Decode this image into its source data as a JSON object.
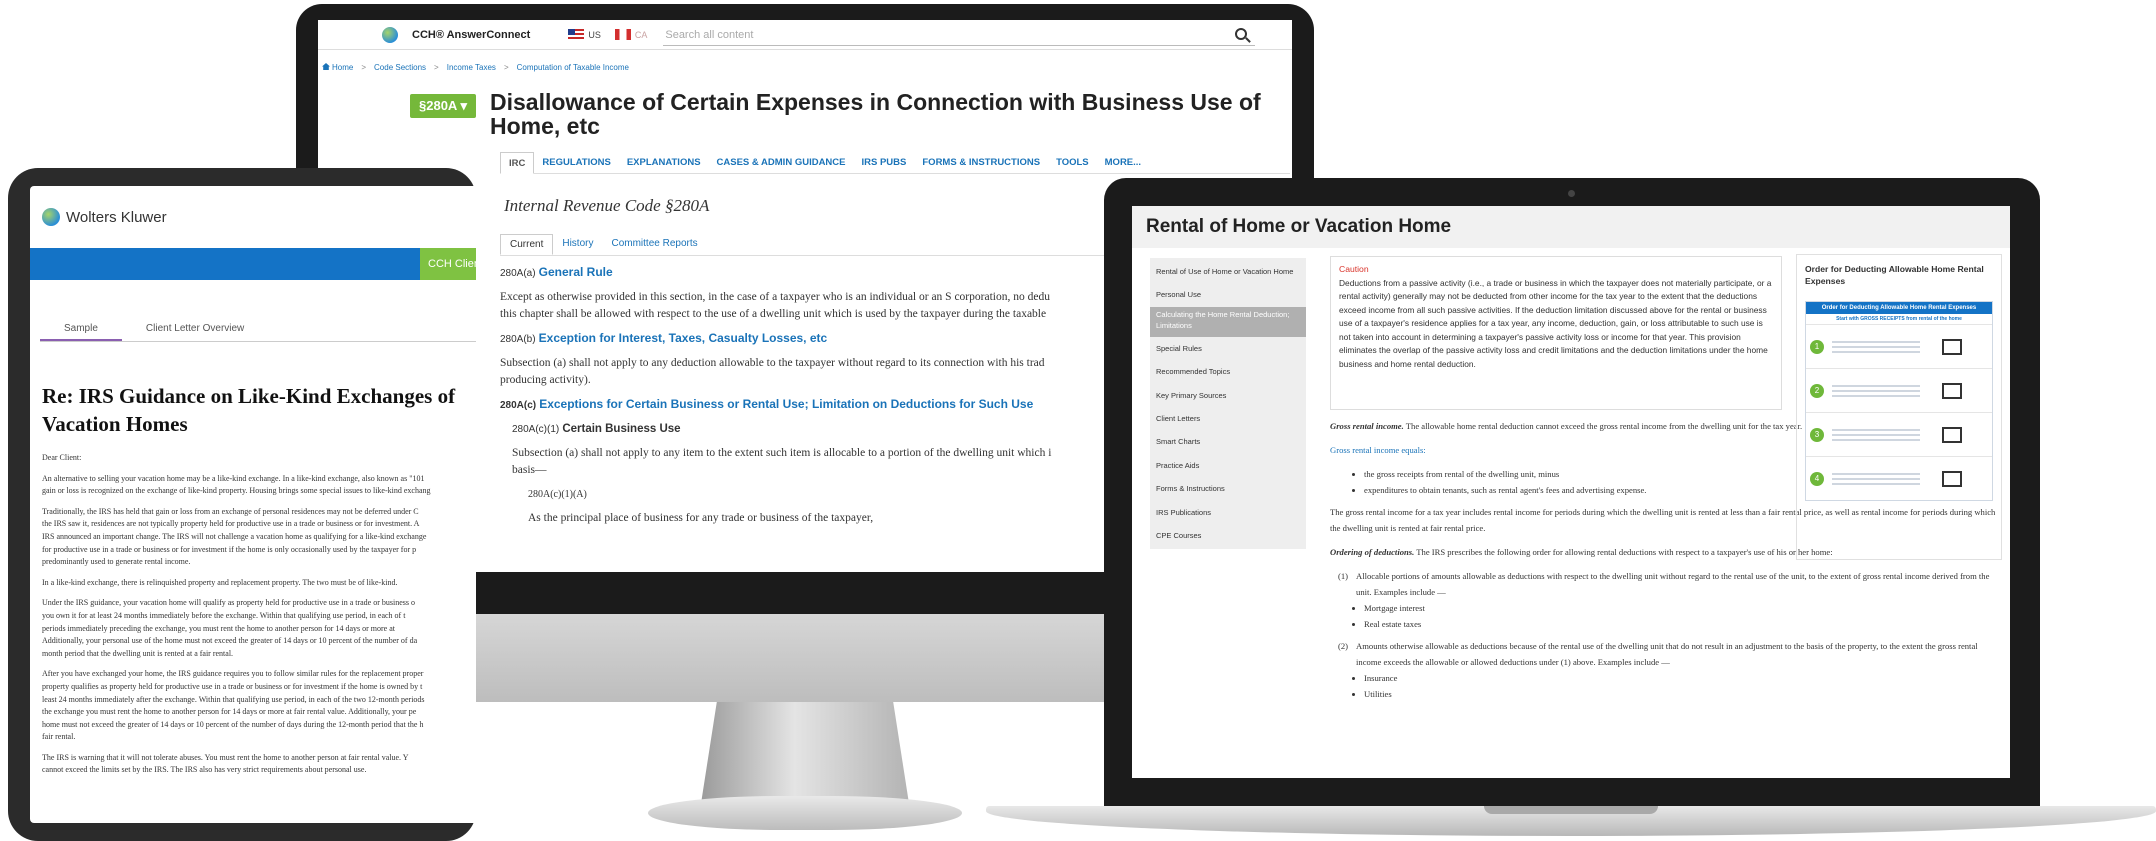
{
  "monitor": {
    "brand": "CCH® AnswerConnect",
    "locale_us": "US",
    "locale_ca": "CA",
    "search_placeholder": "Search all content",
    "breadcrumbs": [
      "Home",
      "Code Sections",
      "Income Taxes",
      "Computation of Taxable Income"
    ],
    "badge": "§280A ▾",
    "title": "Disallowance of Certain Expenses in Connection with Business Use of Home, etc",
    "nav": [
      "IRC",
      "REGULATIONS",
      "EXPLANATIONS",
      "CASES & ADMIN GUIDANCE",
      "IRS PUBS",
      "FORMS & INSTRUCTIONS",
      "TOOLS",
      "MORE..."
    ],
    "section_title": "Internal Revenue Code §280A",
    "tabs": [
      "Current",
      "History",
      "Committee Reports"
    ],
    "sections": [
      {
        "code": "280A(a)",
        "head": "General Rule",
        "text": "Except as otherwise provided in this section, in the case of a taxpayer who is an individual or an S corporation, no dedu",
        "text2": "this chapter shall be allowed with respect to the use of a dwelling unit which is used by the taxpayer during the taxable"
      },
      {
        "code": "280A(b)",
        "head": "Exception for Interest, Taxes, Casualty Losses, etc",
        "text": "Subsection (a) shall not apply to any deduction allowable to the taxpayer without regard to its connection with his trad",
        "text2": "producing activity)."
      },
      {
        "code": "280A(c)",
        "head": "Exceptions for Certain Business or Rental Use; Limitation on Deductions for Such Use"
      }
    ],
    "c1_code": "280A(c)(1)",
    "c1_head": "Certain Business Use",
    "c1_text": "Subsection (a) shall not apply to any item to the extent such item is allocable to a portion of the dwelling unit which i",
    "c1_text2": "basis—",
    "c1a_code": "280A(c)(1)(A)",
    "c1a_text": "As the principal place of business for any trade or business of the taxpayer,"
  },
  "tablet": {
    "logo": "Wolters Kluwer",
    "cch_label": "CCH Client",
    "tabs": [
      "Sample",
      "Client Letter Overview"
    ],
    "title": "Re: IRS Guidance on Like-Kind Exchanges of Vacation Homes",
    "paragraphs": [
      "Dear Client:",
      "An alternative to selling your vacation home may be a like-kind exchange. In a like-kind exchange, also known as \"101",
      "gain or loss is recognized on the exchange of like-kind property. Housing brings some special issues to like-kind exchang",
      "Traditionally, the IRS has held that gain or loss from an exchange of personal residences may not be deferred under C",
      "the IRS saw it, residences are not typically property held for productive use in a trade or business or for investment. A",
      "IRS announced an important change. The IRS will not challenge a vacation home as qualifying for a like-kind exchange",
      "for productive use in a trade or business or for investment if the home is only occasionally used by the taxpayer for p",
      "predominantly used to generate rental income.",
      "In a like-kind exchange, there is relinquished property and replacement property. The two must be of like-kind.",
      "Under the IRS guidance, your vacation home will qualify as property held for productive use in a trade or business o",
      "you own it for at least 24 months immediately before the exchange. Within that qualifying use period, in each of t",
      "periods immediately preceding the exchange, you must rent the home to another person for 14 days or more at",
      "Additionally, your personal use of the home must not exceed the greater of 14 days or 10 percent of the number of da",
      "month period that the dwelling unit is rented at a fair rental.",
      "After you have exchanged your home, the IRS guidance requires you to follow similar rules for the replacement proper",
      "property qualifies as property held for productive use in a trade or business or for investment if the home is owned by t",
      "least 24 months immediately after the exchange. Within that qualifying use period, in each of the two 12-month periods",
      "the exchange you must rent the home to another person for 14 days or more at fair rental value. Additionally, your pe",
      "home must not exceed the greater of 14 days or 10 percent of the number of days during the 12-month period that the h",
      "fair rental.",
      "The IRS is warning that it will not tolerate abuses. You must rent the home to another person at fair rental value. Y",
      "cannot exceed the limits set by the IRS. The IRS also has very strict requirements about personal use."
    ]
  },
  "laptop": {
    "title": "Rental of Home or Vacation Home",
    "sidebar": [
      "Rental of Use of Home or Vacation Home",
      "Personal Use",
      "Calculating the Home Rental Deduction; Limitations",
      "Special Rules",
      "Recommended Topics",
      "Key Primary Sources",
      "Client Letters",
      "Smart Charts",
      "Practice Aids",
      "Forms & Instructions",
      "IRS Publications",
      "CPE Courses"
    ],
    "sidebar_active_index": 2,
    "caution_label": "Caution",
    "caution_text": "Deductions from a passive activity (i.e., a trade or business in which the taxpayer does not materially participate, or a rental activity) generally may not be deducted from other income for the tax year to the extent that the deductions exceed income from all such passive activities. If the deduction limitation discussed above for the rental or business use of a taxpayer's residence applies for a tax year, any income, deduction, gain, or loss attributable to such use is not taken into account in determining a taxpayer's passive activity loss or income for that year. This provision eliminates the overlap of the passive activity loss and credit limitations and the deduction limitations under the home business and home rental deduction.",
    "gross_rental_label": "Gross rental income.",
    "gross_rental_text": "The allowable home rental deduction cannot exceed the gross rental income from the dwelling unit for the tax year.",
    "equals_intro": "Gross rental income equals:",
    "equals_items": [
      "the gross receipts from rental of the dwelling unit, minus",
      "expenditures to obtain tenants, such as rental agent's fees and advertising expense."
    ],
    "includes_text": "The gross rental income for a tax year includes rental income for periods during which the dwelling unit is rented at less than a fair rental price, as well as rental income for periods during which the dwelling unit is rented at fair rental price.",
    "ordering_label": "Ordering of deductions.",
    "ordering_text": "The IRS prescribes the following order for allowing rental deductions with respect to a taxpayer's use of his or her home:",
    "order_1_num": "(1)",
    "order_1": "Allocable portions of amounts allowable as deductions with respect to the dwelling unit without regard to the rental use of the unit, to the extent of gross rental income derived from the unit. Examples include —",
    "order_1_items": [
      "Mortgage interest",
      "Real estate taxes"
    ],
    "order_2_num": "(2)",
    "order_2": "Amounts otherwise allowable as deductions because of the rental use of the dwelling unit that do not result in an adjustment to the basis of the property, to the extent the gross rental income exceeds the allowable or allowed deductions under (1) above. Examples include —",
    "order_2_items": [
      "Insurance",
      "Utilities"
    ],
    "right_title": "Order for Deducting Allowable Home Rental Expenses",
    "flow_head": "Order for Deducting Allowable Home Rental Expenses",
    "flow_sub": "Start with GROSS RECEIPTS from rental of the home",
    "steps": [
      "1",
      "2",
      "3",
      "4"
    ]
  }
}
